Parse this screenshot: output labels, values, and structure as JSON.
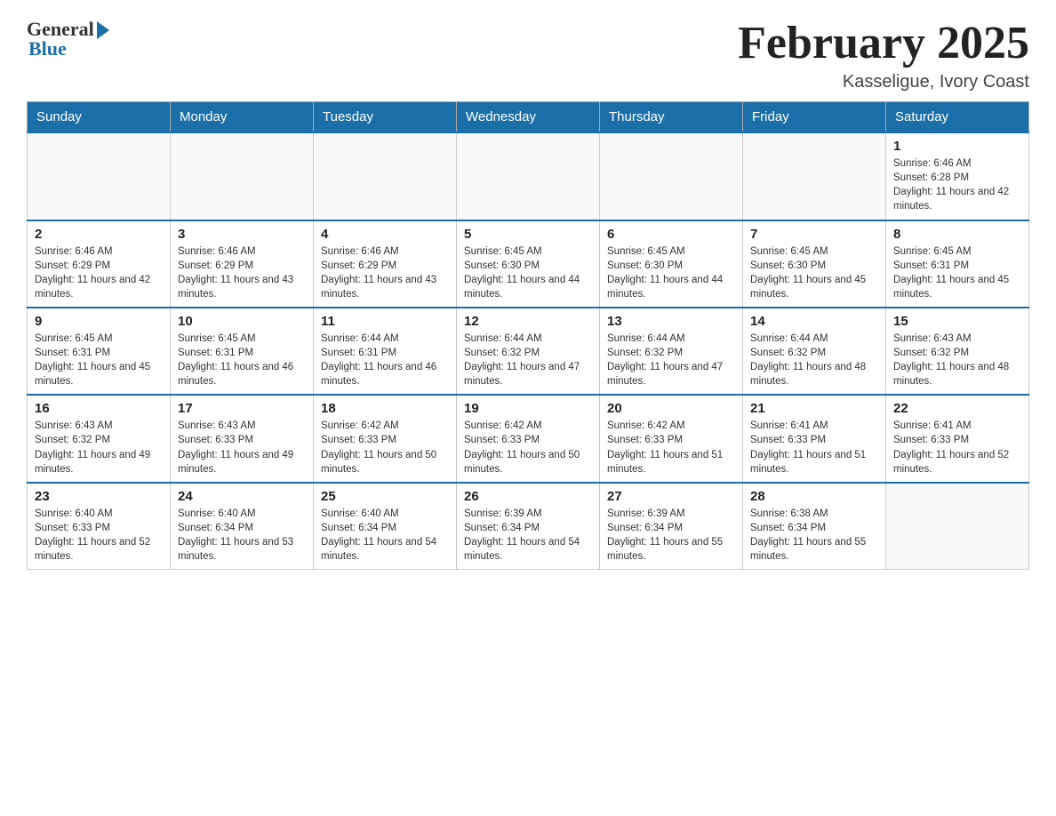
{
  "logo": {
    "general": "General",
    "blue": "Blue"
  },
  "title": "February 2025",
  "location": "Kasseligue, Ivory Coast",
  "days_of_week": [
    "Sunday",
    "Monday",
    "Tuesday",
    "Wednesday",
    "Thursday",
    "Friday",
    "Saturday"
  ],
  "weeks": [
    [
      {
        "day": "",
        "sunrise": "",
        "sunset": "",
        "daylight": ""
      },
      {
        "day": "",
        "sunrise": "",
        "sunset": "",
        "daylight": ""
      },
      {
        "day": "",
        "sunrise": "",
        "sunset": "",
        "daylight": ""
      },
      {
        "day": "",
        "sunrise": "",
        "sunset": "",
        "daylight": ""
      },
      {
        "day": "",
        "sunrise": "",
        "sunset": "",
        "daylight": ""
      },
      {
        "day": "",
        "sunrise": "",
        "sunset": "",
        "daylight": ""
      },
      {
        "day": "1",
        "sunrise": "Sunrise: 6:46 AM",
        "sunset": "Sunset: 6:28 PM",
        "daylight": "Daylight: 11 hours and 42 minutes."
      }
    ],
    [
      {
        "day": "2",
        "sunrise": "Sunrise: 6:46 AM",
        "sunset": "Sunset: 6:29 PM",
        "daylight": "Daylight: 11 hours and 42 minutes."
      },
      {
        "day": "3",
        "sunrise": "Sunrise: 6:46 AM",
        "sunset": "Sunset: 6:29 PM",
        "daylight": "Daylight: 11 hours and 43 minutes."
      },
      {
        "day": "4",
        "sunrise": "Sunrise: 6:46 AM",
        "sunset": "Sunset: 6:29 PM",
        "daylight": "Daylight: 11 hours and 43 minutes."
      },
      {
        "day": "5",
        "sunrise": "Sunrise: 6:45 AM",
        "sunset": "Sunset: 6:30 PM",
        "daylight": "Daylight: 11 hours and 44 minutes."
      },
      {
        "day": "6",
        "sunrise": "Sunrise: 6:45 AM",
        "sunset": "Sunset: 6:30 PM",
        "daylight": "Daylight: 11 hours and 44 minutes."
      },
      {
        "day": "7",
        "sunrise": "Sunrise: 6:45 AM",
        "sunset": "Sunset: 6:30 PM",
        "daylight": "Daylight: 11 hours and 45 minutes."
      },
      {
        "day": "8",
        "sunrise": "Sunrise: 6:45 AM",
        "sunset": "Sunset: 6:31 PM",
        "daylight": "Daylight: 11 hours and 45 minutes."
      }
    ],
    [
      {
        "day": "9",
        "sunrise": "Sunrise: 6:45 AM",
        "sunset": "Sunset: 6:31 PM",
        "daylight": "Daylight: 11 hours and 45 minutes."
      },
      {
        "day": "10",
        "sunrise": "Sunrise: 6:45 AM",
        "sunset": "Sunset: 6:31 PM",
        "daylight": "Daylight: 11 hours and 46 minutes."
      },
      {
        "day": "11",
        "sunrise": "Sunrise: 6:44 AM",
        "sunset": "Sunset: 6:31 PM",
        "daylight": "Daylight: 11 hours and 46 minutes."
      },
      {
        "day": "12",
        "sunrise": "Sunrise: 6:44 AM",
        "sunset": "Sunset: 6:32 PM",
        "daylight": "Daylight: 11 hours and 47 minutes."
      },
      {
        "day": "13",
        "sunrise": "Sunrise: 6:44 AM",
        "sunset": "Sunset: 6:32 PM",
        "daylight": "Daylight: 11 hours and 47 minutes."
      },
      {
        "day": "14",
        "sunrise": "Sunrise: 6:44 AM",
        "sunset": "Sunset: 6:32 PM",
        "daylight": "Daylight: 11 hours and 48 minutes."
      },
      {
        "day": "15",
        "sunrise": "Sunrise: 6:43 AM",
        "sunset": "Sunset: 6:32 PM",
        "daylight": "Daylight: 11 hours and 48 minutes."
      }
    ],
    [
      {
        "day": "16",
        "sunrise": "Sunrise: 6:43 AM",
        "sunset": "Sunset: 6:32 PM",
        "daylight": "Daylight: 11 hours and 49 minutes."
      },
      {
        "day": "17",
        "sunrise": "Sunrise: 6:43 AM",
        "sunset": "Sunset: 6:33 PM",
        "daylight": "Daylight: 11 hours and 49 minutes."
      },
      {
        "day": "18",
        "sunrise": "Sunrise: 6:42 AM",
        "sunset": "Sunset: 6:33 PM",
        "daylight": "Daylight: 11 hours and 50 minutes."
      },
      {
        "day": "19",
        "sunrise": "Sunrise: 6:42 AM",
        "sunset": "Sunset: 6:33 PM",
        "daylight": "Daylight: 11 hours and 50 minutes."
      },
      {
        "day": "20",
        "sunrise": "Sunrise: 6:42 AM",
        "sunset": "Sunset: 6:33 PM",
        "daylight": "Daylight: 11 hours and 51 minutes."
      },
      {
        "day": "21",
        "sunrise": "Sunrise: 6:41 AM",
        "sunset": "Sunset: 6:33 PM",
        "daylight": "Daylight: 11 hours and 51 minutes."
      },
      {
        "day": "22",
        "sunrise": "Sunrise: 6:41 AM",
        "sunset": "Sunset: 6:33 PM",
        "daylight": "Daylight: 11 hours and 52 minutes."
      }
    ],
    [
      {
        "day": "23",
        "sunrise": "Sunrise: 6:40 AM",
        "sunset": "Sunset: 6:33 PM",
        "daylight": "Daylight: 11 hours and 52 minutes."
      },
      {
        "day": "24",
        "sunrise": "Sunrise: 6:40 AM",
        "sunset": "Sunset: 6:34 PM",
        "daylight": "Daylight: 11 hours and 53 minutes."
      },
      {
        "day": "25",
        "sunrise": "Sunrise: 6:40 AM",
        "sunset": "Sunset: 6:34 PM",
        "daylight": "Daylight: 11 hours and 54 minutes."
      },
      {
        "day": "26",
        "sunrise": "Sunrise: 6:39 AM",
        "sunset": "Sunset: 6:34 PM",
        "daylight": "Daylight: 11 hours and 54 minutes."
      },
      {
        "day": "27",
        "sunrise": "Sunrise: 6:39 AM",
        "sunset": "Sunset: 6:34 PM",
        "daylight": "Daylight: 11 hours and 55 minutes."
      },
      {
        "day": "28",
        "sunrise": "Sunrise: 6:38 AM",
        "sunset": "Sunset: 6:34 PM",
        "daylight": "Daylight: 11 hours and 55 minutes."
      },
      {
        "day": "",
        "sunrise": "",
        "sunset": "",
        "daylight": ""
      }
    ]
  ]
}
